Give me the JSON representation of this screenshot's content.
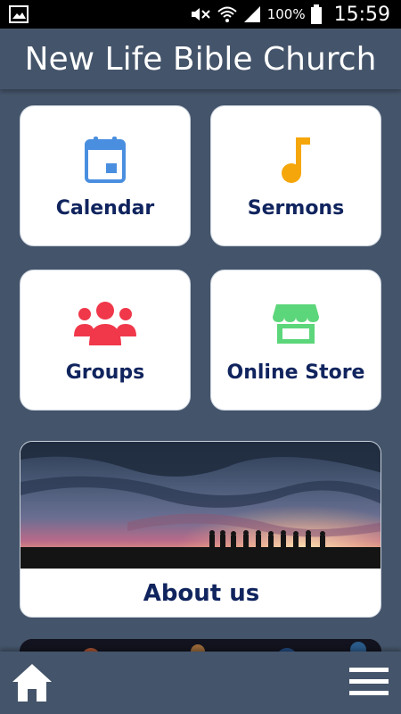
{
  "status_bar": {
    "battery_percent": "100%",
    "time": "15:59"
  },
  "header": {
    "title": "New Life Bible Church"
  },
  "tiles": [
    {
      "label": "Calendar",
      "icon": "calendar-icon",
      "color": "#4a8ee0"
    },
    {
      "label": "Sermons",
      "icon": "music-note-icon",
      "color": "#f5a60a"
    },
    {
      "label": "Groups",
      "icon": "people-icon",
      "color": "#f0384a"
    },
    {
      "label": "Online Store",
      "icon": "store-icon",
      "color": "#5cd67a"
    }
  ],
  "about": {
    "label": "About us"
  },
  "bottom_nav": {
    "home_icon": "home-icon",
    "menu_icon": "hamburger-menu-icon"
  },
  "colors": {
    "background": "#44546a",
    "label_text": "#10245e"
  }
}
